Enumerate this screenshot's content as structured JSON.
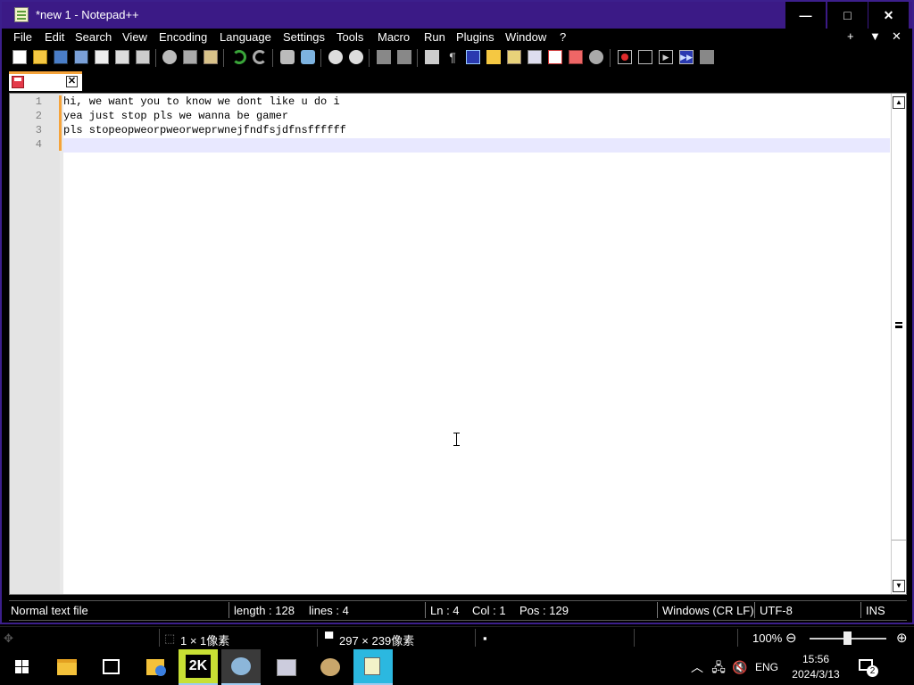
{
  "window": {
    "title": "*new 1 - Notepad++",
    "minimize": "—",
    "maximize": "□",
    "close": "✕"
  },
  "menu": {
    "items": [
      "File",
      "Edit",
      "Search",
      "View",
      "Encoding",
      "Language",
      "Settings",
      "Tools",
      "Macro",
      "Run",
      "Plugins",
      "Window",
      "?"
    ],
    "right": [
      "+",
      "▼",
      "✕"
    ]
  },
  "toolbar": {
    "icons": [
      "new-file-icon",
      "open-file-icon",
      "save-icon",
      "save-all-icon",
      "close-icon",
      "close-all-icon",
      "print-icon",
      "cut-icon",
      "copy-icon",
      "paste-icon",
      "undo-icon",
      "redo-icon",
      "find-icon",
      "replace-icon",
      "zoom-in-icon",
      "zoom-out-icon",
      "sync-vertical-icon",
      "sync-horizontal-icon",
      "word-wrap-icon",
      "show-all-chars-icon",
      "indent-guide-icon",
      "user-defined-language-icon",
      "document-map-icon",
      "document-list-icon",
      "function-list-icon",
      "folder-as-workspace-icon",
      "monitoring-icon",
      "record-macro-icon",
      "stop-macro-icon",
      "play-macro-icon",
      "run-macro-multiple-icon",
      "save-macro-icon"
    ]
  },
  "tab": {
    "close": "✕"
  },
  "editor": {
    "lines": [
      {
        "num": "1",
        "text": "hi, we want you to know we dont like u do i"
      },
      {
        "num": "2",
        "text": "yea just stop pls we wanna be gamer"
      },
      {
        "num": "3",
        "text": "pls stopeopweorpweorweprwnejfndfsjdfnsffffff"
      },
      {
        "num": "4",
        "text": ""
      }
    ]
  },
  "statusbar": {
    "file_type": "Normal text file",
    "length": "length : 128",
    "lines": "lines : 4",
    "ln": "Ln : 4",
    "col": "Col : 1",
    "pos": "Pos : 129",
    "eol": "Windows (CR LF)",
    "encoding": "UTF-8",
    "mode": "INS"
  },
  "viewer": {
    "selection_size": "1 × 1像素",
    "image_size": "297 × 239像素",
    "zoom": "100%"
  },
  "taskbar": {
    "lang": "ENG",
    "time": "15:56",
    "date": "2024/3/13",
    "notification_count": "2"
  }
}
